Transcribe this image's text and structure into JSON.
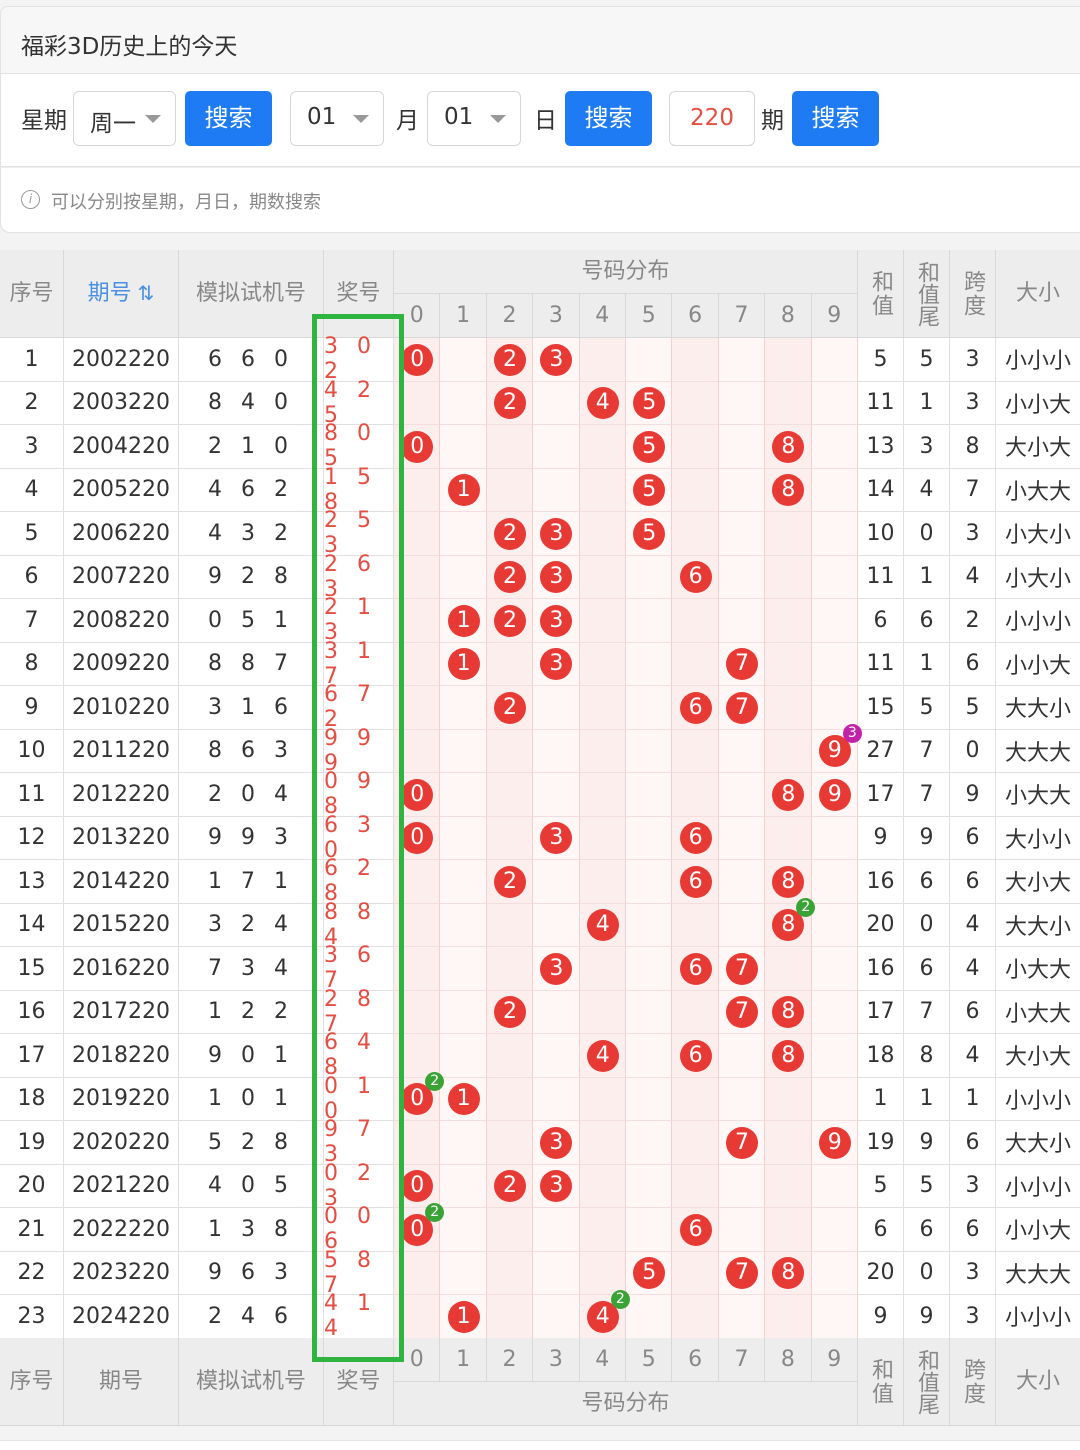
{
  "title": "福彩3D历史上的今天",
  "search": {
    "weekday_label": "星期",
    "weekday_value": "周一",
    "search_label": "搜索",
    "month_value": "01",
    "month_label": "月",
    "day_value": "01",
    "day_label": "日",
    "issue_value": "220",
    "issue_label": "期"
  },
  "tip": "可以分别按星期，月日，期数搜索",
  "table": {
    "headers": {
      "seq": "序号",
      "issue": "期号",
      "sort_icon": "sort-icon",
      "sim": "模拟试机号",
      "prize": "奖号",
      "distribution": "号码分布",
      "digits": [
        "0",
        "1",
        "2",
        "3",
        "4",
        "5",
        "6",
        "7",
        "8",
        "9"
      ],
      "sum": "和值",
      "sum_tail": "和值尾",
      "span": "跨度",
      "size": "大小"
    },
    "rows": [
      {
        "seq": "1",
        "issue": "2002220",
        "sim": "6 6 0",
        "prize": "3 0 2",
        "sum": "5",
        "tail": "5",
        "span": "3",
        "size": "小小小"
      },
      {
        "seq": "2",
        "issue": "2003220",
        "sim": "8 4 0",
        "prize": "4 2 5",
        "sum": "11",
        "tail": "1",
        "span": "3",
        "size": "小小大"
      },
      {
        "seq": "3",
        "issue": "2004220",
        "sim": "2 1 0",
        "prize": "8 0 5",
        "sum": "13",
        "tail": "3",
        "span": "8",
        "size": "大小大"
      },
      {
        "seq": "4",
        "issue": "2005220",
        "sim": "4 6 2",
        "prize": "1 5 8",
        "sum": "14",
        "tail": "4",
        "span": "7",
        "size": "小大大"
      },
      {
        "seq": "5",
        "issue": "2006220",
        "sim": "4 3 2",
        "prize": "2 5 3",
        "sum": "10",
        "tail": "0",
        "span": "3",
        "size": "小大小"
      },
      {
        "seq": "6",
        "issue": "2007220",
        "sim": "9 2 8",
        "prize": "2 6 3",
        "sum": "11",
        "tail": "1",
        "span": "4",
        "size": "小大小"
      },
      {
        "seq": "7",
        "issue": "2008220",
        "sim": "0 5 1",
        "prize": "2 1 3",
        "sum": "6",
        "tail": "6",
        "span": "2",
        "size": "小小小"
      },
      {
        "seq": "8",
        "issue": "2009220",
        "sim": "8 8 7",
        "prize": "3 1 7",
        "sum": "11",
        "tail": "1",
        "span": "6",
        "size": "小小大"
      },
      {
        "seq": "9",
        "issue": "2010220",
        "sim": "3 1 6",
        "prize": "6 7 2",
        "sum": "15",
        "tail": "5",
        "span": "5",
        "size": "大大小"
      },
      {
        "seq": "10",
        "issue": "2011220",
        "sim": "8 6 3",
        "prize": "9 9 9",
        "sum": "27",
        "tail": "7",
        "span": "0",
        "size": "大大大"
      },
      {
        "seq": "11",
        "issue": "2012220",
        "sim": "2 0 4",
        "prize": "0 9 8",
        "sum": "17",
        "tail": "7",
        "span": "9",
        "size": "小大大"
      },
      {
        "seq": "12",
        "issue": "2013220",
        "sim": "9 9 3",
        "prize": "6 3 0",
        "sum": "9",
        "tail": "9",
        "span": "6",
        "size": "大小小"
      },
      {
        "seq": "13",
        "issue": "2014220",
        "sim": "1 7 1",
        "prize": "6 2 8",
        "sum": "16",
        "tail": "6",
        "span": "6",
        "size": "大小大"
      },
      {
        "seq": "14",
        "issue": "2015220",
        "sim": "3 2 4",
        "prize": "8 8 4",
        "sum": "20",
        "tail": "0",
        "span": "4",
        "size": "大大小"
      },
      {
        "seq": "15",
        "issue": "2016220",
        "sim": "7 3 4",
        "prize": "3 6 7",
        "sum": "16",
        "tail": "6",
        "span": "4",
        "size": "小大大"
      },
      {
        "seq": "16",
        "issue": "2017220",
        "sim": "1 2 2",
        "prize": "2 8 7",
        "sum": "17",
        "tail": "7",
        "span": "6",
        "size": "小大大"
      },
      {
        "seq": "17",
        "issue": "2018220",
        "sim": "9 0 1",
        "prize": "6 4 8",
        "sum": "18",
        "tail": "8",
        "span": "4",
        "size": "大小大"
      },
      {
        "seq": "18",
        "issue": "2019220",
        "sim": "1 0 1",
        "prize": "0 1 0",
        "sum": "1",
        "tail": "1",
        "span": "1",
        "size": "小小小"
      },
      {
        "seq": "19",
        "issue": "2020220",
        "sim": "5 2 8",
        "prize": "9 7 3",
        "sum": "19",
        "tail": "9",
        "span": "6",
        "size": "大大小"
      },
      {
        "seq": "20",
        "issue": "2021220",
        "sim": "4 0 5",
        "prize": "0 2 3",
        "sum": "5",
        "tail": "5",
        "span": "3",
        "size": "小小小"
      },
      {
        "seq": "21",
        "issue": "2022220",
        "sim": "1 3 8",
        "prize": "0 0 6",
        "sum": "6",
        "tail": "6",
        "span": "6",
        "size": "小小大"
      },
      {
        "seq": "22",
        "issue": "2023220",
        "sim": "9 6 3",
        "prize": "5 8 7",
        "sum": "20",
        "tail": "0",
        "span": "3",
        "size": "大大大"
      },
      {
        "seq": "23",
        "issue": "2024220",
        "sim": "2 4 6",
        "prize": "4 1 4",
        "sum": "9",
        "tail": "9",
        "span": "3",
        "size": "小小小"
      }
    ],
    "footer": {
      "seq": "序号",
      "issue": "期号",
      "sim": "模拟试机号",
      "prize": "奖号",
      "distribution": "号码分布",
      "sum": "和值",
      "sum_tail": "和值尾",
      "span": "跨度",
      "size": "大小"
    }
  },
  "colors": {
    "accent": "#1e7bf3",
    "prize": "#e54d42",
    "ball": "#e83a35",
    "highlight_box": "#2fb43f",
    "badge_two": "#3aa335",
    "badge_three": "#c023a8"
  }
}
